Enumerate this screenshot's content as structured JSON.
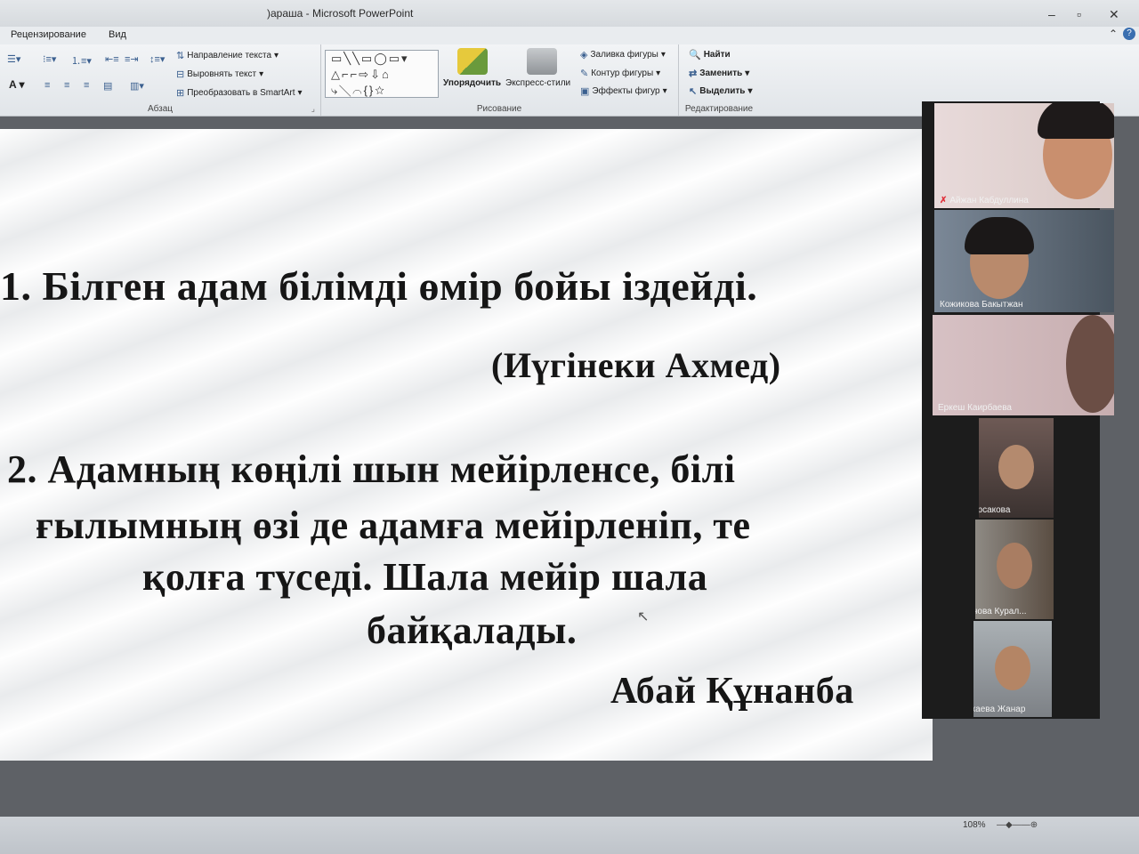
{
  "window": {
    "title": ")араша  -  Microsoft PowerPoint",
    "minimize": "–",
    "restore": "▫",
    "close": "✕"
  },
  "menu": {
    "tabs": [
      "Рецензирование",
      "Вид"
    ],
    "help_icon": "?"
  },
  "ribbon": {
    "paragraph": {
      "label": "Абзац",
      "text_direction": "Направление текста",
      "align_text": "Выровнять текст",
      "convert_smartart": "Преобразовать в SmartArt"
    },
    "drawing": {
      "label": "Рисование",
      "arrange": "Упорядочить",
      "quick_styles": "Экспресс-стили",
      "shape_fill": "Заливка фигуры",
      "shape_outline": "Контур фигуры",
      "shape_effects": "Эффекты фигур"
    },
    "editing": {
      "label": "Редактирование",
      "find": "Найти",
      "replace": "Заменить",
      "select": "Выделить"
    }
  },
  "slide": {
    "quote1": "1. Білген адам білімді өмір бойы іздейді.",
    "author1": "(Иүгінеки Ахмед)",
    "quote2_line1": "2. Адамның көңілі шын мейірленсе, білі",
    "quote2_line2": "ғылымның өзі де адамға мейірленіп, те",
    "quote2_line3": "қолға түседі. Шала мейір шала",
    "quote2_line4": "байқалады.",
    "author2": "Абай Құнанба"
  },
  "participants": [
    {
      "name": "Айжан Кабдуллина",
      "muted": true
    },
    {
      "name": "Кожикова Бакытжан",
      "muted": false
    },
    {
      "name": "Еркеш Каирбаева",
      "muted": false
    },
    {
      "name": "Жадыра Арсакова",
      "muted": false
    },
    {
      "name": "Акрамханова Курал...",
      "muted": true
    },
    {
      "name": "Мусахаева Жанар",
      "muted": true
    }
  ],
  "status": {
    "zoom": "108%"
  }
}
